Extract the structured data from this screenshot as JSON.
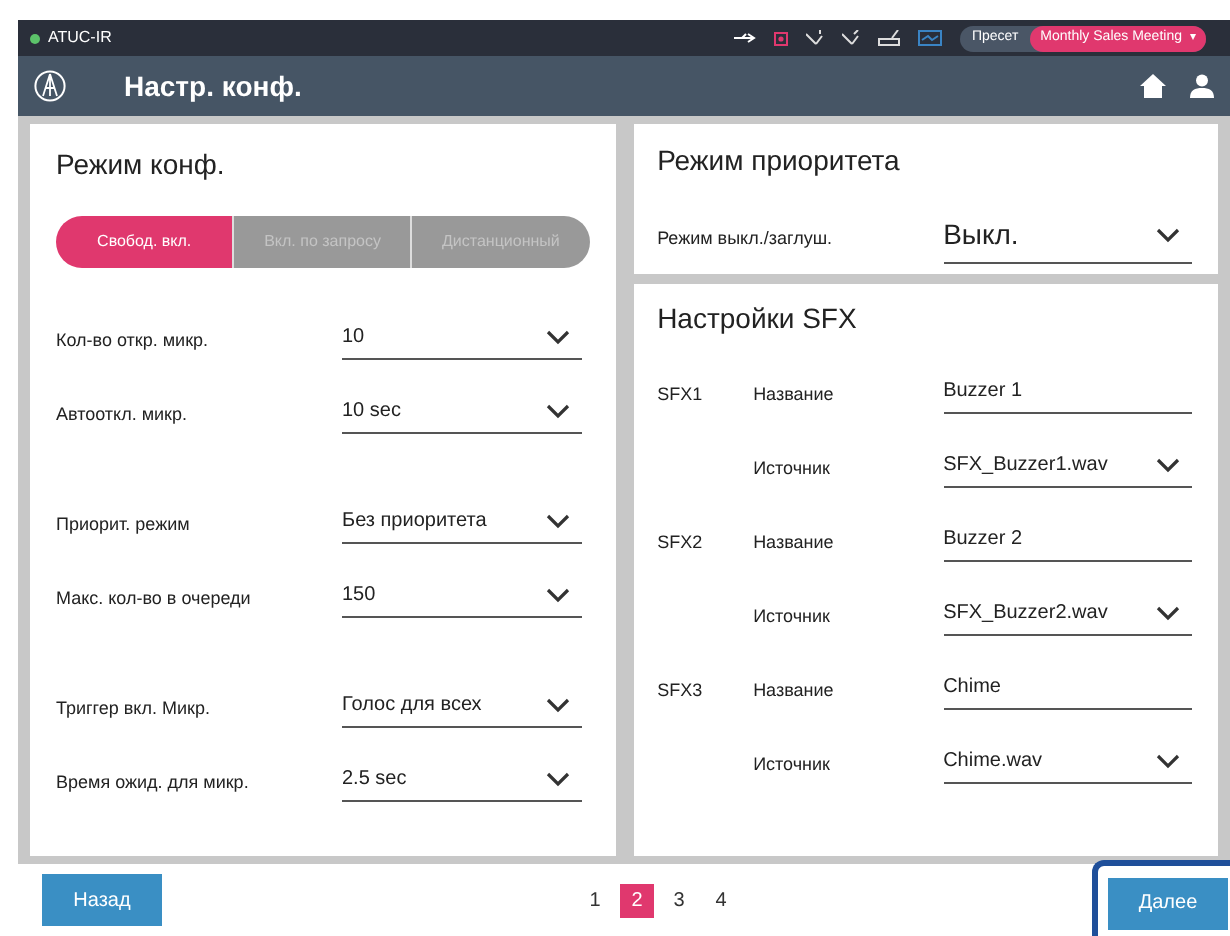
{
  "status_bar": {
    "device": "ATUC-IR",
    "online": true,
    "preset_label": "Пресет",
    "preset_value": "Monthly Sales Meeting",
    "preset_caret": "▾"
  },
  "header": {
    "title": "Настр. конф."
  },
  "conference_mode": {
    "title": "Режим конф.",
    "modes": [
      {
        "label": "Свобод. вкл.",
        "selected": true
      },
      {
        "label": "Вкл. по запросу",
        "selected": false
      },
      {
        "label": "Дистанционный",
        "selected": false
      }
    ],
    "groups": [
      [
        {
          "label": "Кол-во откр. микр.",
          "value": "10"
        },
        {
          "label": "Автооткл. микр.",
          "value": "10 sec"
        }
      ],
      [
        {
          "label": "Приорит. режим",
          "value": "Без приоритета"
        },
        {
          "label": "Макс. кол-во в очереди",
          "value": "150"
        }
      ],
      [
        {
          "label": "Триггер вкл. Микр.",
          "value": "Голос для всех"
        },
        {
          "label": "Время ожид. для микр.",
          "value": "2.5 sec"
        }
      ]
    ]
  },
  "priority_mode": {
    "title": "Режим приоритета",
    "label": "Режим выкл./заглуш.",
    "value": "Выкл."
  },
  "sfx_settings": {
    "title": "Настройки SFX",
    "items": [
      {
        "id_label": "SFX1",
        "name_label": "Название",
        "name": "Buzzer 1",
        "source_label": "Источник",
        "source": "SFX_Buzzer1.wav"
      },
      {
        "id_label": "SFX2",
        "name_label": "Название",
        "name": "Buzzer 2",
        "source_label": "Источник",
        "source": "SFX_Buzzer2.wav"
      },
      {
        "id_label": "SFX3",
        "name_label": "Название",
        "name": "Chime",
        "source_label": "Источник",
        "source": "Chime.wav"
      }
    ]
  },
  "footer": {
    "back": "Назад",
    "next": "Далее",
    "next_focused": true,
    "pages": [
      {
        "label": "1",
        "selected": false
      },
      {
        "label": "2",
        "selected": true
      },
      {
        "label": "3",
        "selected": false
      },
      {
        "label": "4",
        "selected": false
      }
    ]
  }
}
